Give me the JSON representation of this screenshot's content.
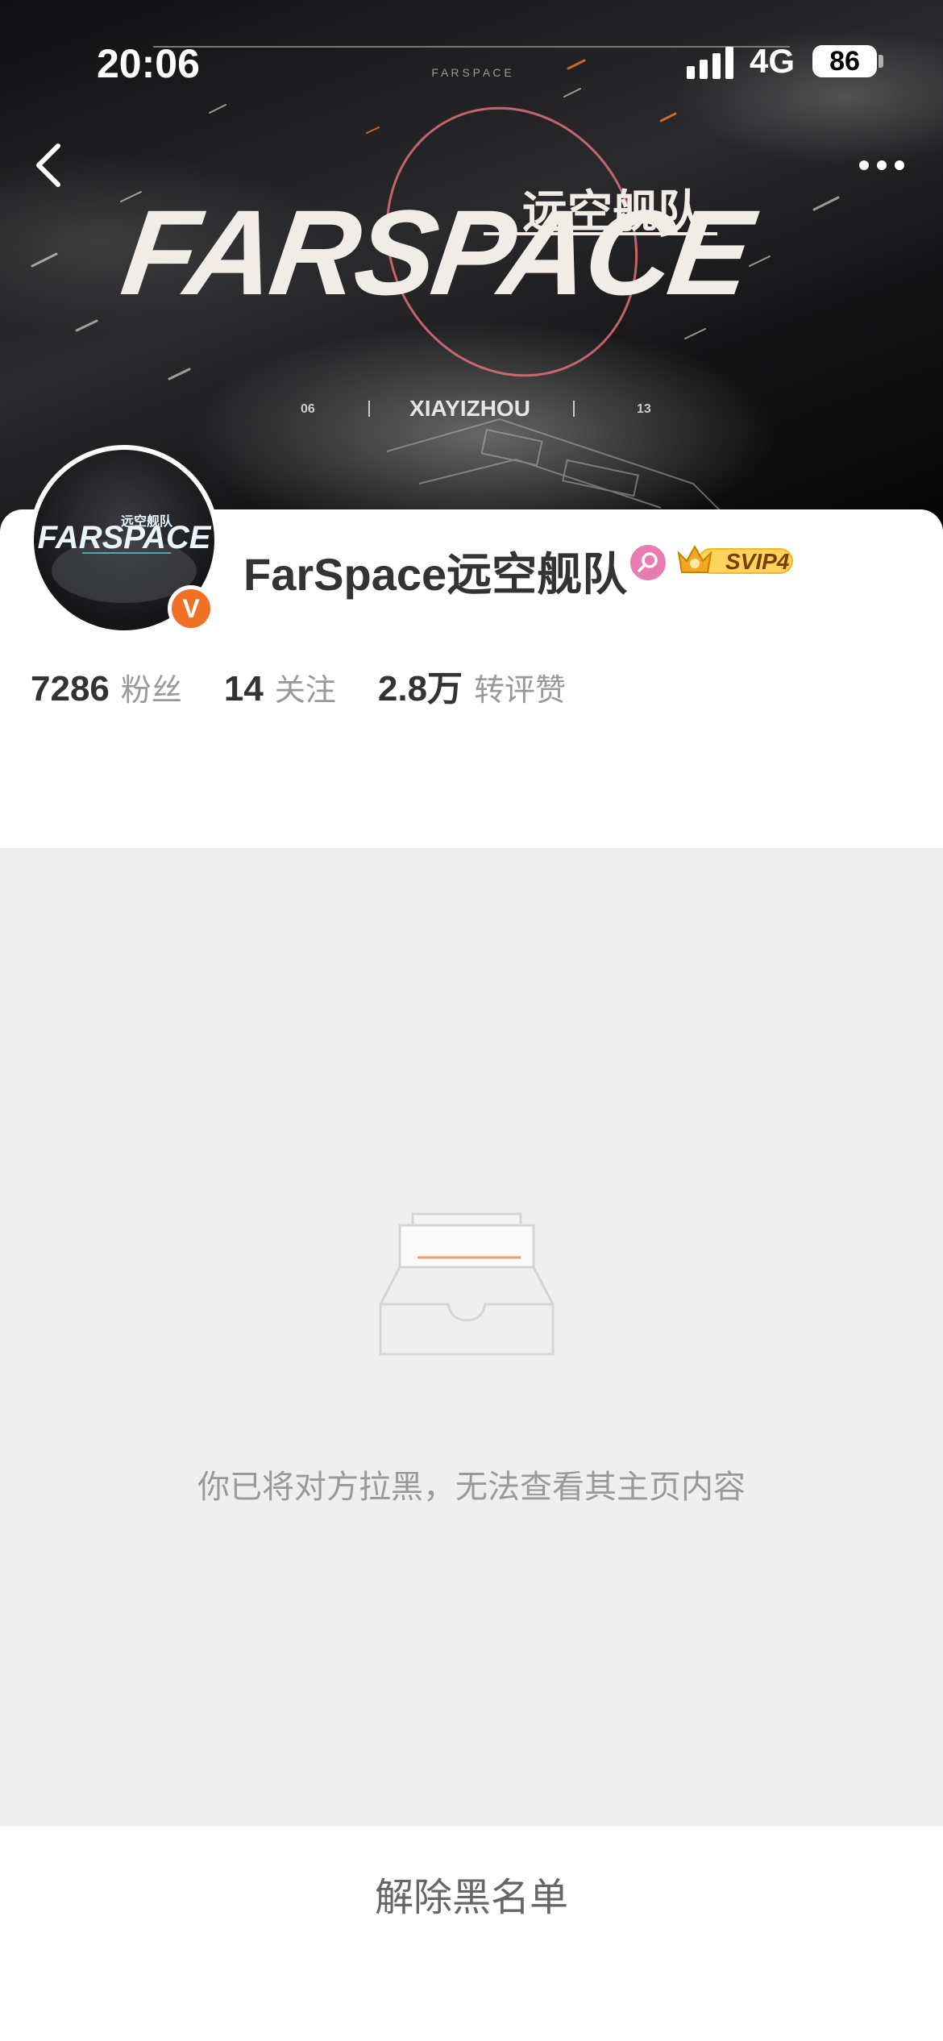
{
  "status_bar": {
    "time": "20:06",
    "network": "4G",
    "battery": "86"
  },
  "header": {
    "back_icon": "chevron-left-icon",
    "more_icon": "more-dots-icon",
    "banner": {
      "wordmark_small": "F A R S P A C E",
      "logo_text": "FARSPACE",
      "logo_cn": "远空舰队",
      "subtitle": "XIAYIZHOU",
      "left_number": "06",
      "right_number": "13"
    }
  },
  "profile": {
    "avatar_logo": "FARSPACE",
    "avatar_cn": "远空舰队",
    "verified_badge": "V",
    "username": "FarSpace远空舰队",
    "gender_icon": "female-icon",
    "vip_badge": "SVIP4",
    "stats": [
      {
        "value": "7286",
        "label": "粉丝"
      },
      {
        "value": "14",
        "label": "关注"
      },
      {
        "value": "2.8万",
        "label": "转评赞"
      }
    ]
  },
  "blocked": {
    "illustration": "empty-inbox-icon",
    "message": "你已将对方拉黑，无法查看其主页内容"
  },
  "footer": {
    "unblock_label": "解除黑名单"
  },
  "colors": {
    "verified": "#f07025",
    "female": "#e87bb1",
    "svip_gold": "#f5b62a",
    "blocked_background": "#efefef"
  }
}
